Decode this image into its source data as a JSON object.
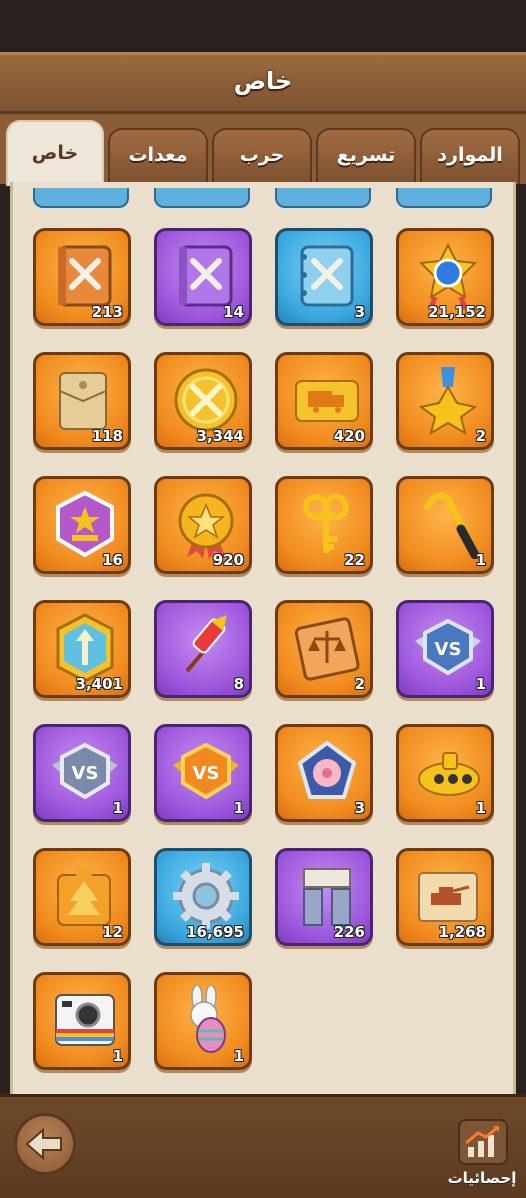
{
  "header": {
    "title": "خاص"
  },
  "tabs": [
    {
      "label": "خاص",
      "active": true
    },
    {
      "label": "معدات",
      "active": false
    },
    {
      "label": "حرب",
      "active": false
    },
    {
      "label": "تسريع",
      "active": false
    },
    {
      "label": "الموارد",
      "active": false
    }
  ],
  "items": [
    {
      "icon": "orange-sword-book-icon",
      "count": "213",
      "color": "orange"
    },
    {
      "icon": "purple-sword-book-icon",
      "count": "14",
      "color": "purple"
    },
    {
      "icon": "blue-sword-book-icon",
      "count": "3",
      "color": "blue"
    },
    {
      "icon": "star-medal-orb-icon",
      "count": "21,152",
      "color": "orange"
    },
    {
      "icon": "envelope-icon",
      "count": "118",
      "color": "orange"
    },
    {
      "icon": "crossed-swords-coin-icon",
      "count": "3,344",
      "color": "orange"
    },
    {
      "icon": "truck-ticket-icon",
      "count": "420",
      "color": "orange"
    },
    {
      "icon": "star-medal-icon",
      "count": "2",
      "color": "orange"
    },
    {
      "icon": "rank-hexagon-badge-icon",
      "count": "16",
      "color": "orange"
    },
    {
      "icon": "star-ribbon-medal-icon",
      "count": "920",
      "color": "orange"
    },
    {
      "icon": "key-icon",
      "count": "22",
      "color": "orange"
    },
    {
      "icon": "crowbar-icon",
      "count": "1",
      "color": "orange"
    },
    {
      "icon": "arrow-hexagon-token-icon",
      "count": "3,401",
      "color": "orange"
    },
    {
      "icon": "firework-rocket-icon",
      "count": "8",
      "color": "purple"
    },
    {
      "icon": "scales-ticket-icon",
      "count": "2",
      "color": "orange"
    },
    {
      "icon": "vs-badge-blue-icon",
      "count": "1",
      "color": "purple"
    },
    {
      "icon": "vs-badge-silver-icon",
      "count": "1",
      "color": "purple"
    },
    {
      "icon": "vs-badge-gold-icon",
      "count": "1",
      "color": "purple"
    },
    {
      "icon": "cherry-blossom-pentagon-icon",
      "count": "3",
      "color": "orange"
    },
    {
      "icon": "golden-submarine-icon",
      "count": "1",
      "color": "orange"
    },
    {
      "icon": "tree-puzzle-piece-icon",
      "count": "12",
      "color": "orange"
    },
    {
      "icon": "gear-icon",
      "count": "16,695",
      "color": "blue"
    },
    {
      "icon": "building-blocks-icon",
      "count": "226",
      "color": "purple"
    },
    {
      "icon": "tank-map-scroll-icon",
      "count": "1,268",
      "color": "orange"
    },
    {
      "icon": "instant-camera-icon",
      "count": "1",
      "color": "orange"
    },
    {
      "icon": "easter-bunny-egg-icon",
      "count": "1",
      "color": "orange"
    }
  ],
  "footer": {
    "back_icon": "back-arrow-icon",
    "stats_icon": "bar-chart-arrow-icon",
    "stats_label": "إحصائيات"
  },
  "colors": {
    "orange_tile": "#f08a1e",
    "purple_tile": "#9b55db",
    "blue_tile": "#3aa6de",
    "panel_bg": "#e9dfcc",
    "wood": "#8a5d36"
  }
}
